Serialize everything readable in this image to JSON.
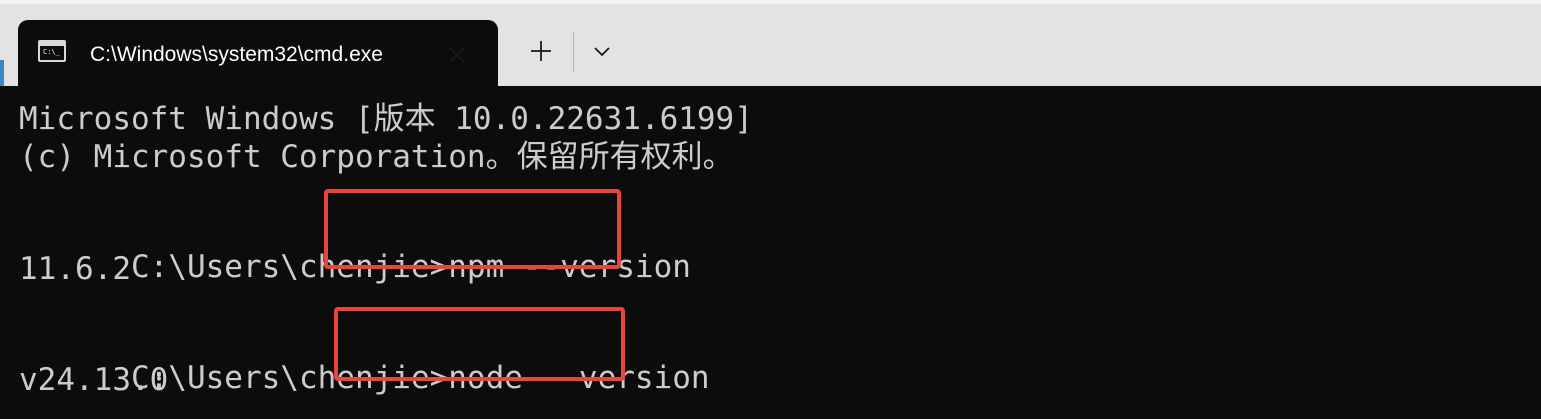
{
  "tab": {
    "title": "C:\\Windows\\system32\\cmd.exe",
    "icon": "console-icon",
    "icon_glyph": "C:\\_"
  },
  "controls": {
    "close_icon": "close-icon",
    "new_tab_icon": "plus-icon",
    "dropdown_icon": "chevron-down-icon"
  },
  "console": {
    "line1": "Microsoft Windows [版本 10.0.22631.6199]",
    "line2": "(c) Microsoft Corporation。保留所有权利。",
    "prompt1": "C:\\Users\\chenjie>",
    "command1": "npm --version",
    "output1": "11.6.2",
    "prompt2": "C:\\Users\\chenjie>",
    "command2": "node --version",
    "output2": "v24.13.0"
  },
  "colors": {
    "console_bg": "#0c0c0c",
    "console_text": "#cccccc",
    "tabstrip_bg": "#e3e3e3",
    "annotation_red": "#e8453c"
  }
}
